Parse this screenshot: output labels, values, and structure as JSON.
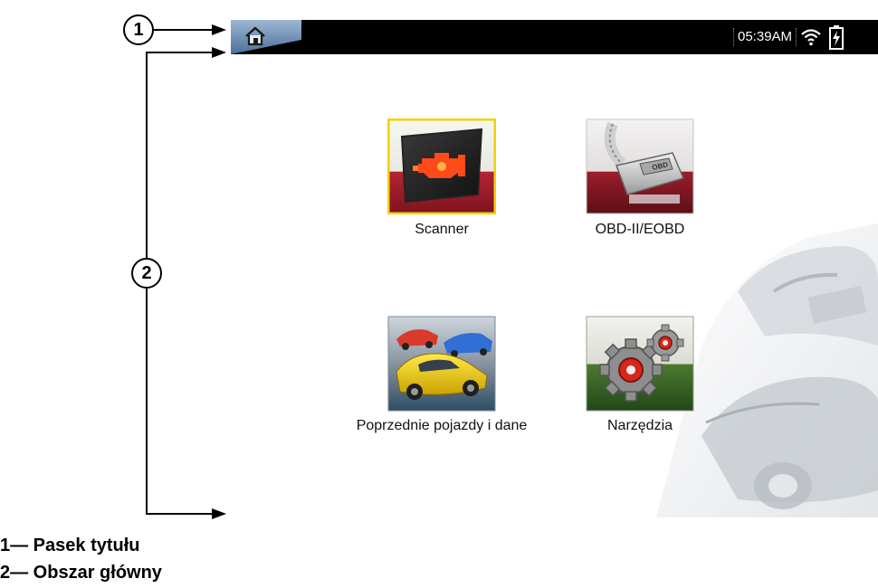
{
  "callouts": [
    "1",
    "2"
  ],
  "legend": [
    "1— Pasek tytułu",
    "2— Obszar główny"
  ],
  "titlebar": {
    "home_icon": "home-icon",
    "clock": "05:39AM",
    "wifi_icon": "wifi-icon",
    "battery_icon": "battery-charging-icon"
  },
  "apps": [
    {
      "label": "Scanner",
      "icon": "engine-warning-icon",
      "selected": true
    },
    {
      "label": "OBD-II/EOBD",
      "icon": "obd-connector-icon",
      "selected": false
    },
    {
      "label": "Poprzednie pojazdy i dane",
      "icon": "vehicles-icon",
      "selected": false
    },
    {
      "label": "Narzędzia",
      "icon": "gears-icon",
      "selected": false
    }
  ],
  "colors": {
    "titlebar": "#000000",
    "selected_border": "#f2d200",
    "home_button": "#6f8fb4"
  }
}
